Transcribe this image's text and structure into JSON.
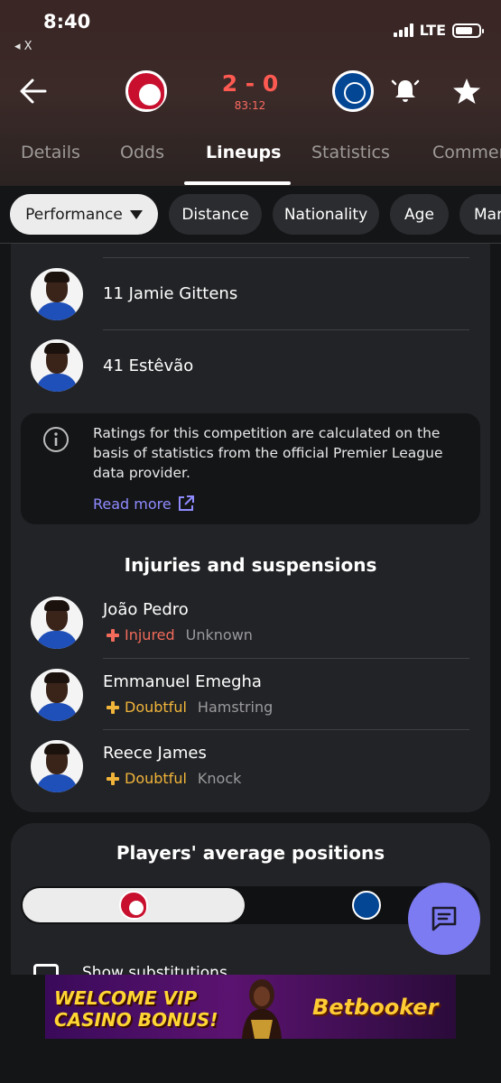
{
  "status_bar": {
    "time": "8:40",
    "back_app": "◂ X",
    "network": "LTE"
  },
  "match": {
    "score": "2 - 0",
    "clock": "83:12"
  },
  "tabs": [
    {
      "label": "Details"
    },
    {
      "label": "Odds"
    },
    {
      "label": "Lineups"
    },
    {
      "label": "Statistics"
    },
    {
      "label": "Commentary"
    }
  ],
  "active_tab": "Lineups",
  "filters": [
    {
      "label": "Performance"
    },
    {
      "label": "Distance"
    },
    {
      "label": "Nationality"
    },
    {
      "label": "Age"
    },
    {
      "label": "Market value"
    }
  ],
  "players": [
    {
      "name": "11 Jamie Gittens"
    },
    {
      "name": "41 Estêvão"
    }
  ],
  "info": {
    "text": "Ratings for this competition are calculated on the basis of statistics from the official Premier League data provider.",
    "link": "Read more"
  },
  "injuries": {
    "title": "Injuries and suspensions",
    "items": [
      {
        "name": "João Pedro",
        "status": "Injured",
        "detail": "Unknown",
        "color": "#f26b5b"
      },
      {
        "name": "Emmanuel Emegha",
        "status": "Doubtful",
        "detail": "Hamstring",
        "color": "#f0b43a"
      },
      {
        "name": "Reece James",
        "status": "Doubtful",
        "detail": "Knock",
        "color": "#f0b43a"
      }
    ]
  },
  "positions": {
    "title": "Players' average positions",
    "toggle_label": "Show substitutions"
  },
  "ad": {
    "line1": "WELCOME VIP",
    "line2": "CASINO BONUS!",
    "brand": "Betbooker"
  },
  "colors": {
    "score": "#ff5a52",
    "accent": "#7d7bf2",
    "link": "#8f8cff"
  }
}
